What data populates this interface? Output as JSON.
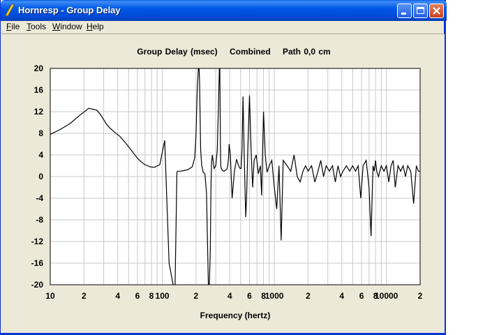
{
  "window": {
    "title": "Hornresp - Group Delay",
    "colors": {
      "titlebar": "#0058e6",
      "frame": "#0831d9",
      "client": "#ece9d8"
    }
  },
  "menu": {
    "items": [
      {
        "id": "file",
        "pre": "",
        "key": "F",
        "post": "ile"
      },
      {
        "id": "tools",
        "pre": "",
        "key": "T",
        "post": "ools"
      },
      {
        "id": "window",
        "pre": "",
        "key": "W",
        "post": "indow"
      },
      {
        "id": "help",
        "pre": "",
        "key": "H",
        "post": "elp"
      }
    ]
  },
  "chart_data": {
    "type": "line",
    "title": "Group Delay (msec)    Combined    Path 0,0 cm",
    "xlabel": "Frequency (hertz)",
    "ylabel": "",
    "x_scale": "log",
    "xlim": [
      10,
      20000
    ],
    "ylim": [
      -20,
      20
    ],
    "yticks": [
      "20",
      "16",
      "12",
      "8",
      "4",
      "0",
      "-4",
      "-8",
      "-12",
      "-16",
      "-20"
    ],
    "xtick_labels": [
      {
        "value": 10,
        "label": "10"
      },
      {
        "value": 20,
        "label": "2"
      },
      {
        "value": 40,
        "label": "4"
      },
      {
        "value": 60,
        "label": "6"
      },
      {
        "value": 80,
        "label": "8"
      },
      {
        "value": 100,
        "label": "100"
      },
      {
        "value": 200,
        "label": "2"
      },
      {
        "value": 400,
        "label": "4"
      },
      {
        "value": 600,
        "label": "6"
      },
      {
        "value": 800,
        "label": "8"
      },
      {
        "value": 1000,
        "label": "1000"
      },
      {
        "value": 2000,
        "label": "2"
      },
      {
        "value": 4000,
        "label": "4"
      },
      {
        "value": 6000,
        "label": "6"
      },
      {
        "value": 8000,
        "label": "8"
      },
      {
        "value": 10000,
        "label": "10000"
      },
      {
        "value": 20000,
        "label": "2"
      }
    ],
    "grid": true,
    "colors": {
      "line": "#000000",
      "grid": "#c8c8c8",
      "plot_bg": "#ffffff"
    },
    "series": [
      {
        "x": [
          10,
          12,
          15,
          18,
          22,
          26,
          28,
          30,
          32,
          34,
          38,
          42,
          48,
          55,
          60,
          65,
          70,
          78,
          85,
          95,
          105,
          115,
          125,
          130,
          133,
          135,
          137,
          140,
          145,
          155,
          170,
          185,
          195,
          200,
          205,
          210,
          213,
          215,
          218,
          220,
          225,
          232,
          240,
          248,
          253,
          258,
          263,
          268,
          272,
          275,
          280,
          290,
          300,
          310,
          318,
          323,
          326,
          329,
          331,
          333,
          336,
          342,
          355,
          368,
          378,
          385,
          390,
          395,
          405,
          420,
          440,
          460,
          480,
          495,
          505,
          515,
          525,
          540,
          555,
          565,
          580,
          600,
          620,
          640,
          660,
          690,
          720,
          750,
          770,
          800,
          830,
          860,
          900,
          950,
          1000,
          1050,
          1100,
          1150,
          1200,
          1300,
          1400,
          1500,
          1600,
          1700,
          1800,
          1900,
          2000,
          2150,
          2300,
          2450,
          2600,
          2750,
          2900,
          3100,
          3300,
          3500,
          3700,
          3900,
          4100,
          4400,
          4700,
          5000,
          5300,
          5600,
          5900,
          6200,
          6600,
          7000,
          7300,
          7600,
          7800,
          8000,
          8200,
          8500,
          9000,
          9500,
          10000,
          10500,
          11000,
          11500,
          12000,
          12700,
          13400,
          14100,
          14800,
          15500,
          16500,
          17500,
          18500,
          19300,
          20000
        ],
        "y": [
          7.8,
          8.6,
          9.8,
          11.2,
          12.6,
          12.3,
          11.5,
          10.5,
          9.6,
          9.0,
          8.1,
          7.4,
          6.0,
          4.4,
          3.4,
          2.7,
          2.2,
          1.8,
          1.7,
          2.2,
          6.7,
          -16,
          -20,
          -20,
          -8,
          0.8,
          1.0,
          1.0,
          1.0,
          1.1,
          1.3,
          1.8,
          3.5,
          8,
          16,
          20,
          20,
          18,
          10,
          5,
          2,
          0.8,
          0.5,
          -3,
          -12,
          -20,
          -20,
          -14,
          -2,
          2.5,
          4,
          1.5,
          2.0,
          5,
          14,
          20,
          20,
          10,
          4,
          2,
          1.5,
          1.2,
          1.0,
          1.2,
          1.4,
          2.2,
          3.5,
          6,
          4,
          -4,
          1,
          3.2,
          2,
          1.5,
          1.5,
          5,
          14.8,
          3,
          -7.5,
          -4,
          5,
          15,
          5,
          -2,
          3,
          4,
          0.5,
          2,
          -3.5,
          12,
          4,
          0.8,
          2,
          3,
          -2,
          -6,
          2,
          -11.8,
          3,
          2,
          1,
          4,
          0,
          -1,
          1,
          2,
          1,
          2,
          -1,
          1,
          3,
          0,
          2,
          1,
          2,
          -1,
          2,
          0,
          1,
          2,
          1,
          2,
          1,
          2,
          -4,
          2,
          3,
          -2,
          -11,
          2,
          1,
          3,
          1,
          0,
          2,
          1,
          2,
          -1,
          2,
          3,
          -2,
          2,
          1,
          2,
          0,
          2,
          1,
          -5,
          2,
          1,
          1
        ]
      }
    ]
  }
}
